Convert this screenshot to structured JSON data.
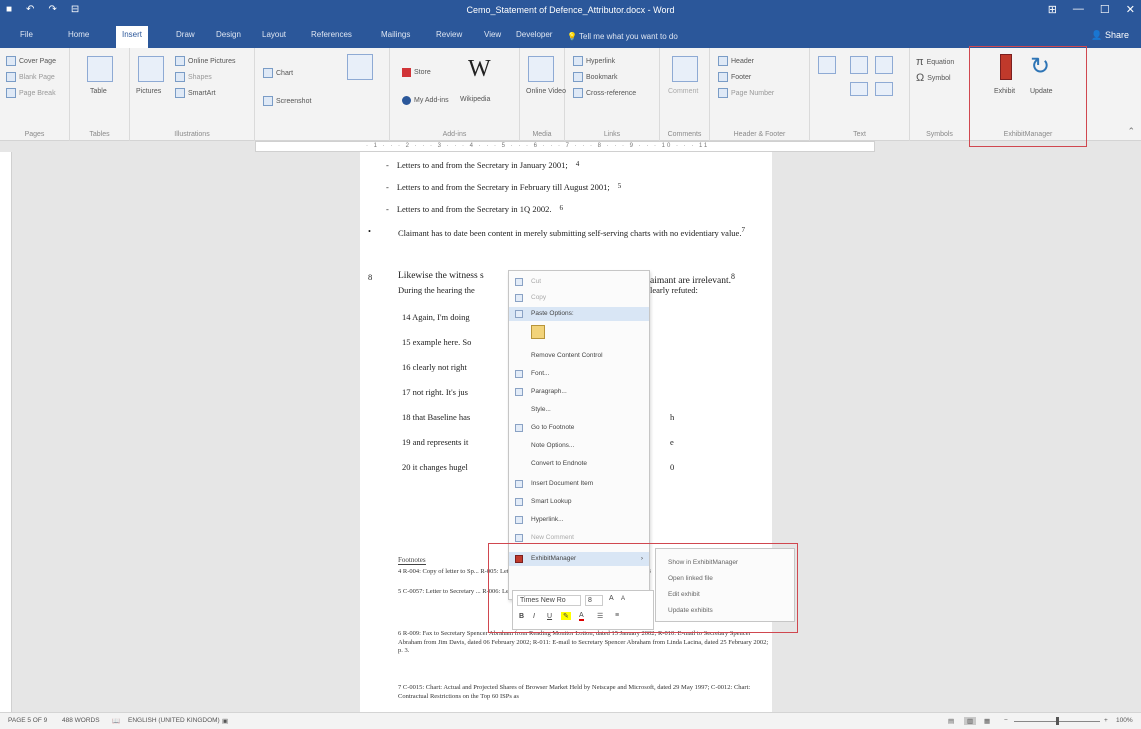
{
  "window": {
    "title": "Cemo_Statement of Defence_Attributor.docx - Word",
    "qat": [
      "■",
      "↶",
      "↷",
      "⊟"
    ],
    "controls": [
      "⊞",
      "—",
      "☐",
      "✕"
    ]
  },
  "tabs": [
    "File",
    "Home",
    "Insert",
    "Draw",
    "Design",
    "Layout",
    "References",
    "Mailings",
    "Review",
    "View",
    "Developer"
  ],
  "active_tab": "Insert",
  "tell_me": "Tell me what you want to do",
  "share": "Share",
  "ribbon": {
    "pages": {
      "items": [
        "Cover Page",
        "Blank Page",
        "Page Break"
      ],
      "label": "Pages"
    },
    "tables": {
      "items": [
        "Table"
      ],
      "label": "Tables"
    },
    "illustrations": {
      "items": [
        "Pictures",
        "Online Pictures",
        "Shapes",
        "SmartArt",
        "Chart",
        "Screenshot"
      ],
      "label": "Illustrations"
    },
    "addins": {
      "items": [
        "Store",
        "My Add-ins",
        "Wikipedia"
      ],
      "label": "Add-ins"
    },
    "media": {
      "items": [
        "Online Video"
      ],
      "label": "Media"
    },
    "links": {
      "items": [
        "Hyperlink",
        "Bookmark",
        "Cross-reference"
      ],
      "label": "Links"
    },
    "comments": {
      "items": [
        "Comment"
      ],
      "label": "Comments"
    },
    "header_footer": {
      "items": [
        "Header",
        "Footer",
        "Page Number"
      ],
      "label": "Header & Footer"
    },
    "text": {
      "label": "Text"
    },
    "symbols": {
      "items": [
        "Equation",
        "Symbol"
      ],
      "label": "Symbols"
    },
    "exhibit_manager": {
      "items": [
        "Exhibit",
        "Update"
      ],
      "label": "ExhibitManager"
    }
  },
  "document": {
    "bullets": [
      "Letters to and from the Secretary in January 2001;",
      "Letters to and from the Secretary in February till August 2001;",
      "Letters to and from the Secretary in 1Q 2002."
    ],
    "bullet_footnotes": [
      "4",
      "5",
      "6"
    ],
    "para1": "Claimant has to date been content in merely submitting self-serving charts with no evidentiary value.",
    "para1_footnote": "7",
    "para2_number": "8",
    "para2_line1_left": "Likewise the witness s",
    "para2_line1_right": "aimant are irrelevant.",
    "para2_footnote": "8",
    "para2_line2_left": "During the hearing the",
    "para2_line2_right": "learly refuted:",
    "quotes": [
      {
        "left": "14 Again, I'm doing",
        "right": ""
      },
      {
        "left": "15 example here. So",
        "right": ""
      },
      {
        "left": "16 clearly not right",
        "right": ""
      },
      {
        "left": "17 not right. It's jus",
        "right": ""
      },
      {
        "left": "18 that Baseline has",
        "right": "h"
      },
      {
        "left": "19 and represents it",
        "right": "e"
      },
      {
        "left": "20 it changes hugel",
        "right": "0"
      }
    ],
    "footnote_separator": "Footnotes",
    "footnotes": [
      "4 R-004: Copy of letter to Sp... R-005: Letter to Secretary Abraham from Robert Pickel, dated 18",
      "5 C-0057: Letter to Secretary ... R-006: Letter to Secretary Ab... to Secretary Spencer Abraham",
      "6 R-009: Fax to Secretary Spencer Abraham from Reading Monitor Lotion, dated 15 January 2002; R-010: E-mail to Secretary Spencer Abraham from Jim Davis, dated 06 February 2002; R-011: E-mail to Secretary Spencer Abraham from Linda Lacina, dated 25 February 2002; p. 3.",
      "7 C-0015: Chart: Actual and Projected Shares of Browser Market Held by Netscape and Microsoft, dated 29 May 1997; C-0012: Chart: Contractual Restrictions on the Top 60 ISPs as"
    ]
  },
  "context_menu": [
    {
      "label": "Cut",
      "disabled": true
    },
    {
      "label": "Copy",
      "disabled": true
    },
    {
      "label": "Paste Options:",
      "disabled": false,
      "highlight": true
    },
    {
      "label": "",
      "disabled": false
    },
    {
      "label": "Remove Content Control",
      "disabled": false
    },
    {
      "label": "Font...",
      "disabled": false
    },
    {
      "label": "Paragraph...",
      "disabled": false
    },
    {
      "label": "Style...",
      "disabled": false
    },
    {
      "label": "Go to Footnote",
      "disabled": false
    },
    {
      "label": "Note Options...",
      "disabled": false
    },
    {
      "label": "Convert to Endnote",
      "disabled": false
    },
    {
      "label": "Insert Document Item",
      "disabled": false
    },
    {
      "label": "Smart Lookup",
      "disabled": false
    },
    {
      "label": "Hyperlink...",
      "disabled": false
    },
    {
      "label": "New Comment",
      "disabled": true
    },
    {
      "label": "ExhibitManager",
      "disabled": false,
      "highlight": true
    }
  ],
  "mini_toolbar": {
    "font": "Times New Ro",
    "size": "8",
    "buttons": [
      "B",
      "I",
      "U"
    ]
  },
  "submenu": [
    "Show in ExhibitManager",
    "Open linked file",
    "Edit exhibit",
    "Update exhibits"
  ],
  "statusbar": {
    "page": "PAGE 5 OF 9",
    "words": "488 WORDS",
    "language": "ENGLISH (UNITED KINGDOM)",
    "zoom": "100%"
  }
}
